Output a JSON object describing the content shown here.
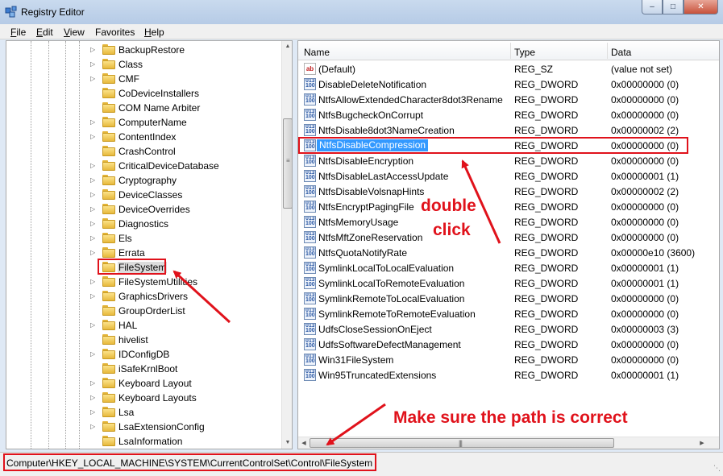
{
  "window": {
    "title": "Registry Editor",
    "minimize_glyph": "–",
    "maximize_glyph": "□",
    "close_glyph": "✕"
  },
  "menu": [
    {
      "label": "File",
      "accel": "F",
      "rest": "ile"
    },
    {
      "label": "Edit",
      "accel": "E",
      "rest": "dit"
    },
    {
      "label": "View",
      "accel": "V",
      "rest": "iew"
    },
    {
      "label": "Favorites",
      "accel": "",
      "rest": "Favorites"
    },
    {
      "label": "Help",
      "accel": "H",
      "rest": "elp"
    }
  ],
  "tree": {
    "items": [
      {
        "label": "BackupRestore",
        "expandable": true
      },
      {
        "label": "Class",
        "expandable": true
      },
      {
        "label": "CMF",
        "expandable": true
      },
      {
        "label": "CoDeviceInstallers",
        "expandable": false
      },
      {
        "label": "COM Name Arbiter",
        "expandable": false
      },
      {
        "label": "ComputerName",
        "expandable": true
      },
      {
        "label": "ContentIndex",
        "expandable": true
      },
      {
        "label": "CrashControl",
        "expandable": false
      },
      {
        "label": "CriticalDeviceDatabase",
        "expandable": true
      },
      {
        "label": "Cryptography",
        "expandable": true
      },
      {
        "label": "DeviceClasses",
        "expandable": true
      },
      {
        "label": "DeviceOverrides",
        "expandable": true
      },
      {
        "label": "Diagnostics",
        "expandable": true
      },
      {
        "label": "Els",
        "expandable": true
      },
      {
        "label": "Errata",
        "expandable": true
      },
      {
        "label": "FileSystem",
        "expandable": false,
        "selected": true
      },
      {
        "label": "FileSystemUtilities",
        "expandable": true
      },
      {
        "label": "GraphicsDrivers",
        "expandable": true
      },
      {
        "label": "GroupOrderList",
        "expandable": false
      },
      {
        "label": "HAL",
        "expandable": true
      },
      {
        "label": "hivelist",
        "expandable": false
      },
      {
        "label": "IDConfigDB",
        "expandable": true
      },
      {
        "label": "iSafeKrnlBoot",
        "expandable": false
      },
      {
        "label": "Keyboard Layout",
        "expandable": true
      },
      {
        "label": "Keyboard Layouts",
        "expandable": true
      },
      {
        "label": "Lsa",
        "expandable": true
      },
      {
        "label": "LsaExtensionConfig",
        "expandable": true
      },
      {
        "label": "LsaInformation",
        "expandable": false
      }
    ]
  },
  "list": {
    "columns": {
      "name": "Name",
      "type": "Type",
      "data": "Data"
    },
    "rows": [
      {
        "name": "(Default)",
        "type": "REG_SZ",
        "data": "(value not set)",
        "icon": "sz"
      },
      {
        "name": "DisableDeleteNotification",
        "type": "REG_DWORD",
        "data": "0x00000000 (0)",
        "icon": "dword"
      },
      {
        "name": "NtfsAllowExtendedCharacter8dot3Rename",
        "type": "REG_DWORD",
        "data": "0x00000000 (0)",
        "icon": "dword"
      },
      {
        "name": "NtfsBugcheckOnCorrupt",
        "type": "REG_DWORD",
        "data": "0x00000000 (0)",
        "icon": "dword"
      },
      {
        "name": "NtfsDisable8dot3NameCreation",
        "type": "REG_DWORD",
        "data": "0x00000002 (2)",
        "icon": "dword"
      },
      {
        "name": "NtfsDisableCompression",
        "type": "REG_DWORD",
        "data": "0x00000000 (0)",
        "icon": "dword",
        "selected": true
      },
      {
        "name": "NtfsDisableEncryption",
        "type": "REG_DWORD",
        "data": "0x00000000 (0)",
        "icon": "dword"
      },
      {
        "name": "NtfsDisableLastAccessUpdate",
        "type": "REG_DWORD",
        "data": "0x00000001 (1)",
        "icon": "dword"
      },
      {
        "name": "NtfsDisableVolsnapHints",
        "type": "REG_DWORD",
        "data": "0x00000002 (2)",
        "icon": "dword"
      },
      {
        "name": "NtfsEncryptPagingFile",
        "type": "REG_DWORD",
        "data": "0x00000000 (0)",
        "icon": "dword"
      },
      {
        "name": "NtfsMemoryUsage",
        "type": "REG_DWORD",
        "data": "0x00000000 (0)",
        "icon": "dword"
      },
      {
        "name": "NtfsMftZoneReservation",
        "type": "REG_DWORD",
        "data": "0x00000000 (0)",
        "icon": "dword"
      },
      {
        "name": "NtfsQuotaNotifyRate",
        "type": "REG_DWORD",
        "data": "0x00000e10 (3600)",
        "icon": "dword"
      },
      {
        "name": "SymlinkLocalToLocalEvaluation",
        "type": "REG_DWORD",
        "data": "0x00000001 (1)",
        "icon": "dword"
      },
      {
        "name": "SymlinkLocalToRemoteEvaluation",
        "type": "REG_DWORD",
        "data": "0x00000001 (1)",
        "icon": "dword"
      },
      {
        "name": "SymlinkRemoteToLocalEvaluation",
        "type": "REG_DWORD",
        "data": "0x00000000 (0)",
        "icon": "dword"
      },
      {
        "name": "SymlinkRemoteToRemoteEvaluation",
        "type": "REG_DWORD",
        "data": "0x00000000 (0)",
        "icon": "dword"
      },
      {
        "name": "UdfsCloseSessionOnEject",
        "type": "REG_DWORD",
        "data": "0x00000003 (3)",
        "icon": "dword"
      },
      {
        "name": "UdfsSoftwareDefectManagement",
        "type": "REG_DWORD",
        "data": "0x00000000 (0)",
        "icon": "dword"
      },
      {
        "name": "Win31FileSystem",
        "type": "REG_DWORD",
        "data": "0x00000000 (0)",
        "icon": "dword"
      },
      {
        "name": "Win95TruncatedExtensions",
        "type": "REG_DWORD",
        "data": "0x00000001 (1)",
        "icon": "dword"
      }
    ]
  },
  "status": {
    "path": "Computer\\HKEY_LOCAL_MACHINE\\SYSTEM\\CurrentControlSet\\Control\\FileSystem"
  },
  "annotations": {
    "double_click_line1": "double",
    "double_click_line2": "click",
    "path_note": "Make sure the path is correct",
    "color": "#e0121b"
  }
}
